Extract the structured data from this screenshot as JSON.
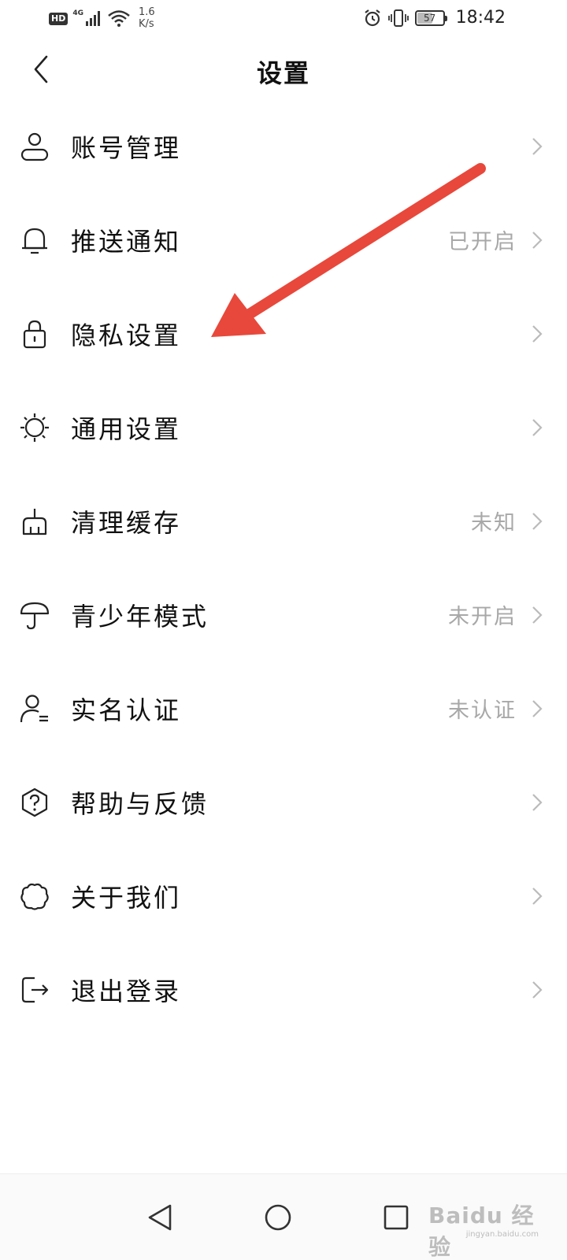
{
  "status_bar": {
    "hd": "HD",
    "network": "4G",
    "speed_value": "1.6",
    "speed_unit": "K/s",
    "battery_level": "57",
    "battery_fraction": 0.57,
    "time": "18:42"
  },
  "header": {
    "title": "设置"
  },
  "settings": [
    {
      "label": "账号管理",
      "value": "",
      "icon": "user-icon"
    },
    {
      "label": "推送通知",
      "value": "已开启",
      "icon": "bell-icon"
    },
    {
      "label": "隐私设置",
      "value": "",
      "icon": "lock-icon"
    },
    {
      "label": "通用设置",
      "value": "",
      "icon": "sun-icon"
    },
    {
      "label": "清理缓存",
      "value": "未知",
      "icon": "broom-icon"
    },
    {
      "label": "青少年模式",
      "value": "未开启",
      "icon": "umbrella-icon"
    },
    {
      "label": "实名认证",
      "value": "未认证",
      "icon": "user-id-icon"
    },
    {
      "label": "帮助与反馈",
      "value": "",
      "icon": "help-icon"
    },
    {
      "label": "关于我们",
      "value": "",
      "icon": "paw-icon"
    },
    {
      "label": "退出登录",
      "value": "",
      "icon": "logout-icon"
    }
  ],
  "watermark": {
    "brand": "Baidu 经验",
    "site": "jingyan.baidu.com"
  },
  "colors": {
    "annotation_arrow": "#e8483b",
    "secondary_text": "#a8a8a8"
  }
}
